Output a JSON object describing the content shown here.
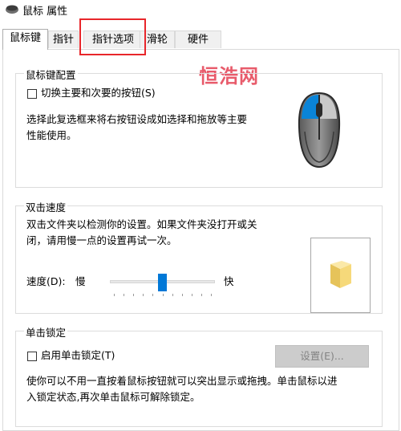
{
  "window": {
    "title": "鼠标 属性"
  },
  "tabs": [
    {
      "label": "鼠标键",
      "active": true
    },
    {
      "label": "指针",
      "active": false
    },
    {
      "label": "指针选项",
      "active": false,
      "highlighted": true
    },
    {
      "label": "滑轮",
      "active": false
    },
    {
      "label": "硬件",
      "active": false
    }
  ],
  "watermark": "恒浩网",
  "button_config": {
    "legend": "鼠标键配置",
    "checkbox_label": "切换主要和次要的按钮(S)",
    "checked": false,
    "description_line1": "选择此复选框来将右按钮设成如选择和拖放等主要",
    "description_line2": "性能使用。"
  },
  "double_click": {
    "legend": "双击速度",
    "description_line1": "双击文件夹以检测你的设置。如果文件夹没打开或关",
    "description_line2": "闭，请用慢一点的设置再试一次。",
    "speed_label": "速度(D):",
    "slow_label": "慢",
    "fast_label": "快",
    "speed_fraction": 0.5
  },
  "click_lock": {
    "legend": "单击锁定",
    "checkbox_label": "启用单击锁定(T)",
    "checked": false,
    "settings_button": "设置(E)...",
    "description_line1": "使你可以不用一直按着鼠标按钮就可以突出显示或拖拽。单击鼠标以进",
    "description_line2": "入锁定状态,再次单击鼠标可解除锁定。"
  },
  "colors": {
    "accent": "#0078d7",
    "highlight_box": "#e8262b",
    "watermark": "#e85b6b"
  }
}
